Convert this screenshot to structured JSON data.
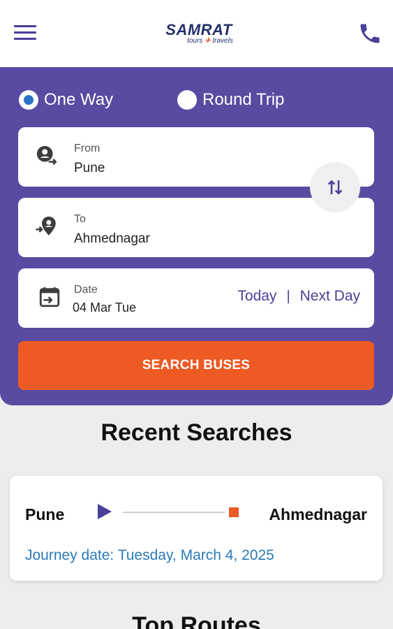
{
  "header": {
    "logo_main": "SAMRAT",
    "logo_sub_left": "tours",
    "logo_sub_right": "travels",
    "menu_icon": "hamburger-menu-icon",
    "phone_icon": "phone-icon"
  },
  "trip_type": {
    "options": [
      "One Way",
      "Round Trip"
    ],
    "selected": "One Way"
  },
  "from": {
    "caption": "From",
    "value": "Pune",
    "icon": "person-depart-icon"
  },
  "to": {
    "caption": "To",
    "value": "Ahmednagar",
    "icon": "location-arrive-icon"
  },
  "date": {
    "caption": "Date",
    "value": "04 Mar Tue",
    "icon": "calendar-icon",
    "today_label": "Today",
    "separator": "|",
    "next_day_label": "Next Day"
  },
  "swap_icon": "swap-vertical-icon",
  "search_button_label": "SEARCH BUSES",
  "recent_searches": {
    "title": "Recent Searches",
    "items": [
      {
        "from": "Pune",
        "to": "Ahmednagar",
        "journey_date": "Journey date: Tuesday, March 4, 2025"
      }
    ]
  },
  "top_routes": {
    "title": "Top Routes"
  },
  "colors": {
    "brand_purple": "#584ba1",
    "accent_orange": "#ed5a23",
    "link_blue": "#2a7ab8"
  }
}
